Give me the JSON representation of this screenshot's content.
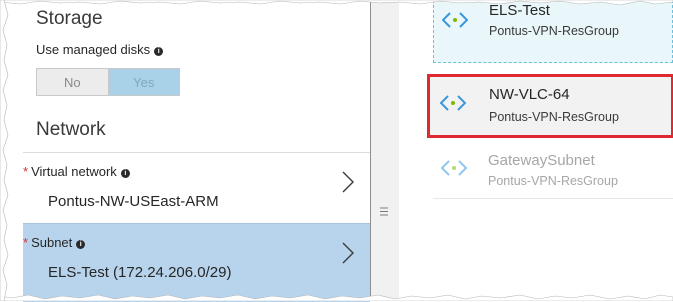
{
  "storage": {
    "title": "Storage",
    "managed_disks_label": "Use managed disks",
    "toggle": {
      "no_label": "No",
      "yes_label": "Yes",
      "selected": "Yes"
    }
  },
  "network": {
    "title": "Network",
    "virtual_network": {
      "required_mark": "*",
      "label": "Virtual network",
      "value": "Pontus-NW-USEast-ARM"
    },
    "subnet": {
      "required_mark": "*",
      "label": "Subnet",
      "value": "ELS-Test (172.24.206.0/29)"
    }
  },
  "subnet_list": {
    "items": [
      {
        "name": "ELS-Test",
        "group": "Pontus-VPN-ResGroup",
        "state": "selected",
        "icon": "vnet-icon"
      },
      {
        "name": "NW-VLC-64",
        "group": "Pontus-VPN-ResGroup",
        "state": "highlighted",
        "icon": "vnet-icon"
      },
      {
        "name": "GatewaySubnet",
        "group": "Pontus-VPN-ResGroup",
        "state": "disabled",
        "icon": "vnet-icon"
      }
    ]
  },
  "colors": {
    "accent_blue": "#a9d2e8",
    "selected_row": "#b8d4ec",
    "highlight_red": "#e0282f",
    "required_red": "#d13438",
    "icon_blue": "#3a96dd",
    "icon_green": "#7fba00"
  }
}
